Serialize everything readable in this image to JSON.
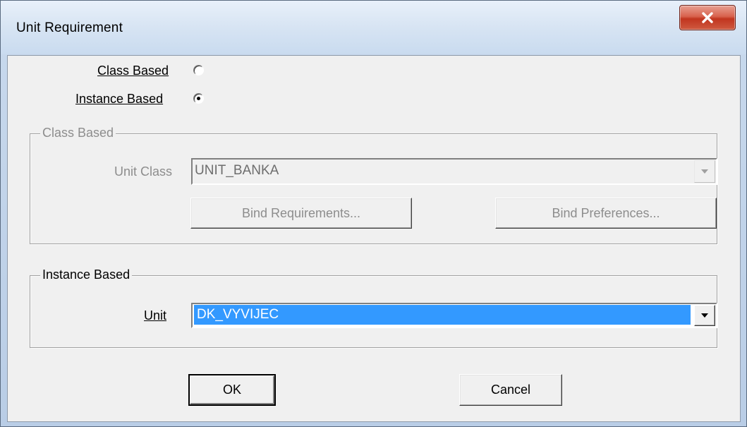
{
  "window": {
    "title": "Unit Requirement",
    "close_icon": "close-x-icon"
  },
  "mode": {
    "class_based_label": "Class Based",
    "instance_based_label": "Instance Based",
    "selected": "Instance Based"
  },
  "class_group": {
    "legend": "Class Based",
    "enabled": false,
    "unit_class_label": "Unit Class",
    "unit_class_value": "UNIT_BANKA",
    "bind_requirements_label": "Bind Requirements...",
    "bind_preferences_label": "Bind Preferences..."
  },
  "instance_group": {
    "legend": "Instance Based",
    "unit_label": "Unit",
    "unit_value": "DK_VYVIJEC"
  },
  "buttons": {
    "ok_label": "OK",
    "cancel_label": "Cancel"
  },
  "colors": {
    "selection": "#3399ff",
    "disabled_text": "#8d8d8d",
    "close_button": "#c1351f"
  }
}
